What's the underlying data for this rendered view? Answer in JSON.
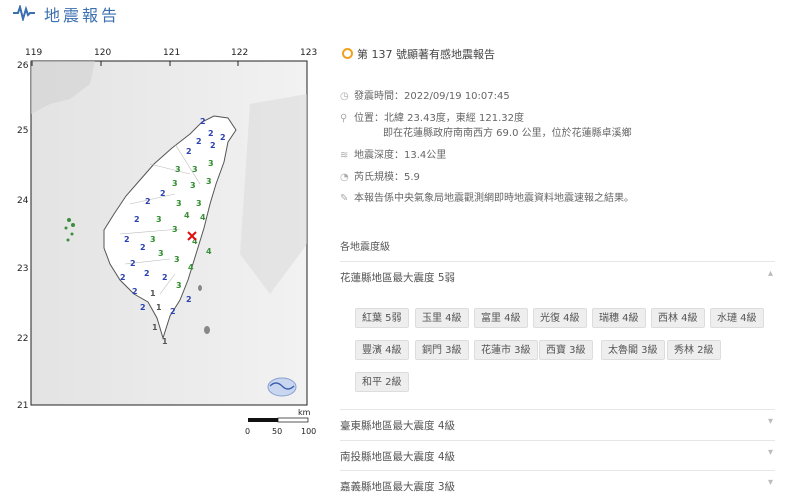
{
  "header": {
    "title": "地震報告"
  },
  "map": {
    "lon_ticks": [
      "119",
      "120",
      "121",
      "122",
      "123"
    ],
    "lat_ticks": [
      "26",
      "25",
      "24",
      "23",
      "22",
      "21"
    ],
    "scale": {
      "unit": "km",
      "ticks": [
        "0",
        "50",
        "100"
      ]
    },
    "intensities": [
      {
        "v": "2",
        "c": "#2a3fb0"
      },
      {
        "v": "2",
        "c": "#2a3fb0"
      },
      {
        "v": "2",
        "c": "#2a3fb0"
      },
      {
        "v": "2",
        "c": "#2a3fb0"
      },
      {
        "v": "2",
        "c": "#2a3fb0"
      },
      {
        "v": "2",
        "c": "#2a3fb0"
      },
      {
        "v": "3",
        "c": "#2e8b2e"
      },
      {
        "v": "3",
        "c": "#2e8b2e"
      },
      {
        "v": "3",
        "c": "#2e8b2e"
      },
      {
        "v": "3",
        "c": "#2e8b2e"
      },
      {
        "v": "3",
        "c": "#2e8b2e"
      },
      {
        "v": "3",
        "c": "#2e8b2e"
      },
      {
        "v": "2",
        "c": "#2a3fb0"
      },
      {
        "v": "2",
        "c": "#2a3fb0"
      },
      {
        "v": "3",
        "c": "#2e8b2e"
      },
      {
        "v": "3",
        "c": "#2e8b2e"
      },
      {
        "v": "4",
        "c": "#3a8f3a"
      },
      {
        "v": "4",
        "c": "#3a8f3a"
      },
      {
        "v": "2",
        "c": "#2a3fb0"
      },
      {
        "v": "3",
        "c": "#2e8b2e"
      },
      {
        "v": "3",
        "c": "#2e8b2e"
      },
      {
        "v": "4",
        "c": "#3a8f3a"
      },
      {
        "v": "4",
        "c": "#3a8f3a"
      },
      {
        "v": "3",
        "c": "#2e8b2e"
      },
      {
        "v": "2",
        "c": "#2a3fb0"
      },
      {
        "v": "2",
        "c": "#2a3fb0"
      },
      {
        "v": "3",
        "c": "#2e8b2e"
      },
      {
        "v": "3",
        "c": "#2e8b2e"
      },
      {
        "v": "4",
        "c": "#3a8f3a"
      },
      {
        "v": "2",
        "c": "#2a3fb0"
      },
      {
        "v": "2",
        "c": "#2a3fb0"
      },
      {
        "v": "2",
        "c": "#2a3fb0"
      },
      {
        "v": "2",
        "c": "#2a3fb0"
      },
      {
        "v": "3",
        "c": "#2e8b2e"
      },
      {
        "v": "1",
        "c": "#555555"
      },
      {
        "v": "2",
        "c": "#2a3fb0"
      },
      {
        "v": "2",
        "c": "#2a3fb0"
      },
      {
        "v": "1",
        "c": "#555555"
      },
      {
        "v": "2",
        "c": "#2a3fb0"
      },
      {
        "v": "1",
        "c": "#555555"
      },
      {
        "v": "1",
        "c": "#555555"
      },
      {
        "v": "2",
        "c": "#2a3fb0"
      }
    ]
  },
  "report": {
    "title": "第 137 號顯著有感地震報告",
    "time": "發震時間：2022/09/19 10:07:45",
    "location": "位置：北緯 23.43度，東經 121.32度",
    "location_detail": "即在花蓮縣政府南南西方 69.0 公里，位於花蓮縣卓溪鄉",
    "depth": "地震深度：13.4公里",
    "magnitude": "芮氏規模：5.9",
    "note": "本報告係中央氣象局地震觀測網即時地震資料地震速報之結果。"
  },
  "intensity_section": {
    "title": "各地震度級",
    "regions": [
      {
        "label": "花蓮縣地區最大震度 5弱"
      },
      {
        "label": "臺東縣地區最大震度 4級"
      },
      {
        "label": "南投縣地區最大震度 4級"
      },
      {
        "label": "嘉義縣地區最大震度 3級"
      }
    ],
    "hualien_stations": [
      "紅葉 5弱",
      "玉里 4級",
      "富里 4級",
      "光復 4級",
      "瑞穗 4級",
      "西林 4級",
      "水璉 4級",
      "豐濱 4級",
      "銅門 3級",
      "花蓮市 3級",
      "西寶 3級",
      "太魯閣 3級",
      "秀林 2級",
      "和平 2級"
    ]
  }
}
